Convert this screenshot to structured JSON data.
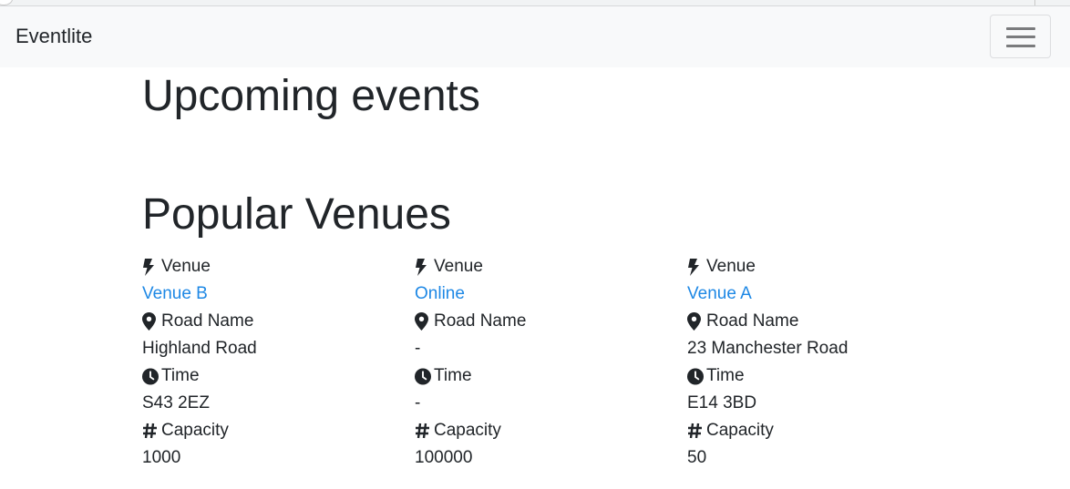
{
  "navbar": {
    "brand": "Eventlite"
  },
  "main": {
    "upcoming_heading": "Upcoming events",
    "venues_heading": "Popular Venues"
  },
  "labels": {
    "venue": "Venue",
    "road": "Road Name",
    "time": "Time",
    "capacity": "Capacity"
  },
  "icons": {
    "venue": "bolt-icon",
    "road": "map-marker-icon",
    "time": "clock-icon",
    "capacity": "hash-icon"
  },
  "colors": {
    "link": "#1e88e5",
    "navbar_bg": "#f8f9fa",
    "text": "#212529"
  },
  "venues": [
    {
      "name": "Venue B",
      "road": "Highland Road",
      "time": "S43 2EZ",
      "capacity": "1000"
    },
    {
      "name": "Online",
      "road": "-",
      "time": "-",
      "capacity": "100000"
    },
    {
      "name": "Venue A",
      "road": "23 Manchester Road",
      "time": "E14 3BD",
      "capacity": "50"
    }
  ]
}
